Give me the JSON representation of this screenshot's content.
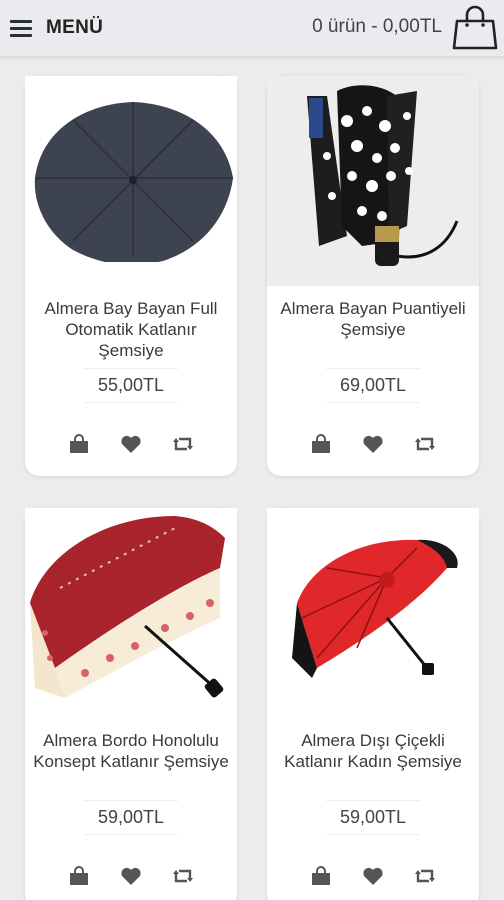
{
  "header": {
    "menu_label": "MENÜ",
    "cart_summary": "0 ürün - 0,00TL"
  },
  "products": [
    {
      "name": "Almera Bay Bayan Full Otomatik Katlanır Şemsiye",
      "price": "55,00TL"
    },
    {
      "name": "Almera Bayan Puantiyeli Şemsiye",
      "price": "69,00TL"
    },
    {
      "name": "Almera Bordo Honolulu Konsept Katlanır Şemsiye",
      "price": "59,00TL"
    },
    {
      "name": "Almera Dışı Çiçekli Katlanır Kadın Şemsiye",
      "price": "59,00TL"
    }
  ],
  "icons": {
    "menu": "hamburger-menu-icon",
    "cart": "shopping-bag-icon",
    "add_to_cart": "shopping-bag-icon",
    "wishlist": "heart-icon",
    "compare": "retweet-arrows-icon"
  },
  "colors": {
    "header_bg": "#e9ebee",
    "page_bg": "#ececec",
    "card_bg": "#ffffff",
    "icon": "#555555"
  }
}
